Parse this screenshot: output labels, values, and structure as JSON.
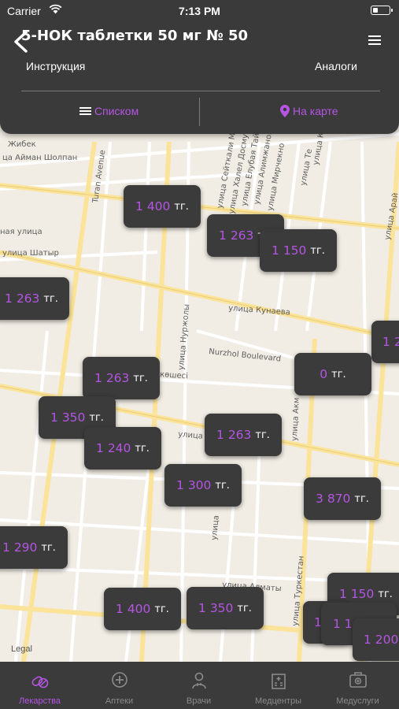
{
  "status_bar": {
    "carrier": "Carrier",
    "time": "7:13 PM"
  },
  "header": {
    "title": "5-НОК таблетки 50 мг № 50",
    "instructions_label": "Инструкция",
    "analogs_label": "Аналоги",
    "list_view_label": "Списком",
    "map_view_label": "На карте"
  },
  "map": {
    "legal_label": "Legal",
    "streets": [
      "Жибек",
      "ца Айман Шолпан",
      "Turan Avenue",
      "улица Сейткали Менд",
      "улица Халел Досмухам",
      "улица Елубая Тайбеко",
      "улица Алимжанов",
      "улица Мирчекно",
      "улица Те",
      "улица Кар",
      "улица Арай",
      "улица Шатыр",
      "ная улица",
      "улица Кунаева",
      "улица Нуржолы",
      "Nurzhol Boulevard",
      "көшесі",
      "улица",
      "улица Акм",
      "улица Алматы",
      "улица Туркестан",
      "улица"
    ],
    "currency": "тг.",
    "markers": [
      {
        "price": "1 400"
      },
      {
        "price": "1 263"
      },
      {
        "price": "1 150"
      },
      {
        "price": "1 263"
      },
      {
        "price": "1 2"
      },
      {
        "price": "0"
      },
      {
        "price": "1 263"
      },
      {
        "price": "1 350"
      },
      {
        "price": "1 263"
      },
      {
        "price": "1 240"
      },
      {
        "price": "1 300"
      },
      {
        "price": "3 870"
      },
      {
        "price": "1 290"
      },
      {
        "price": "1 150"
      },
      {
        "price": "1 400"
      },
      {
        "price": "1 350"
      },
      {
        "price": "1"
      },
      {
        "price": "1 1"
      },
      {
        "price": "1 200"
      }
    ]
  },
  "tabs": [
    {
      "label": "Лекарства",
      "icon": "pills-icon",
      "active": true
    },
    {
      "label": "Аптеки",
      "icon": "pharmacy-cross-icon",
      "active": false
    },
    {
      "label": "Врачи",
      "icon": "doctor-icon",
      "active": false
    },
    {
      "label": "Медцентры",
      "icon": "hospital-building-icon",
      "active": false
    },
    {
      "label": "Медуслуги",
      "icon": "medical-kit-icon",
      "active": false
    }
  ],
  "colors": {
    "accent": "#b455e3",
    "header_bg": "#3a3a3a",
    "map_bg": "#f1ede4",
    "road": "#fbe39a"
  }
}
